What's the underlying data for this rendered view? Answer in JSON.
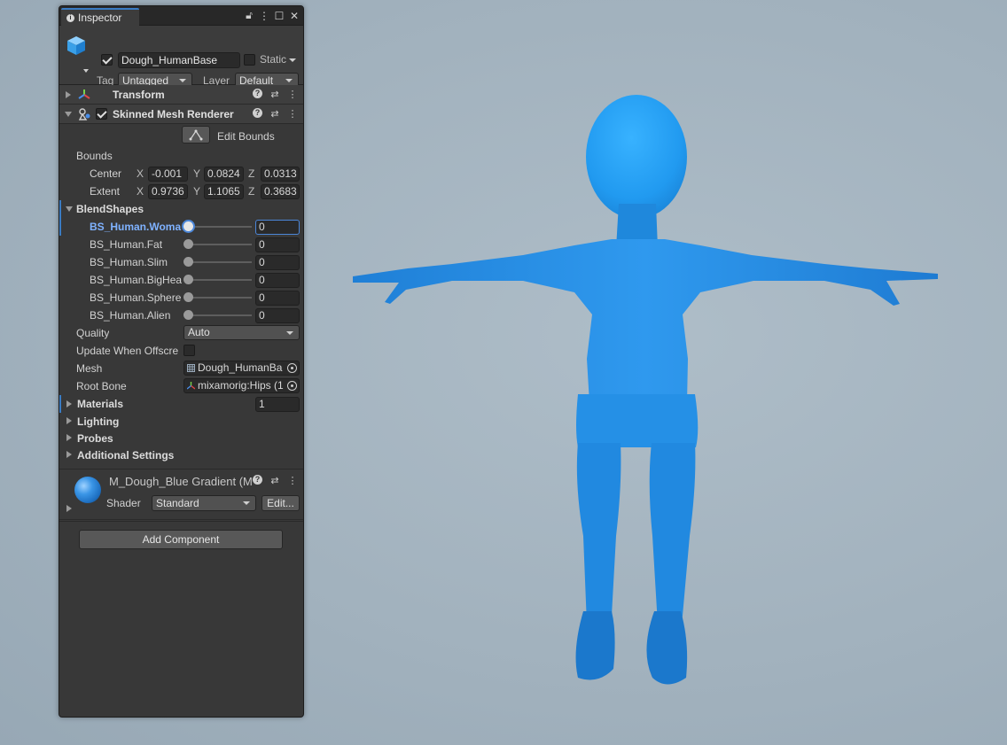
{
  "colors": {
    "character": "#2a90e8",
    "viewport": "#a3b3bf",
    "panel": "#383838",
    "accent": "#3a7cc4"
  },
  "inspector": {
    "tab_label": "Inspector",
    "window_icons": [
      "lock-icon",
      "menu-dots-icon",
      "maximize-icon",
      "close-icon"
    ],
    "object": {
      "active": true,
      "name": "Dough_HumanBase",
      "static_label": "Static",
      "tag_label": "Tag",
      "tag_value": "Untagged",
      "layer_label": "Layer",
      "layer_value": "Default"
    },
    "transform": {
      "title": "Transform"
    },
    "skinned_mesh": {
      "title": "Skinned Mesh Renderer",
      "enabled": true,
      "edit_bounds_label": "Edit Bounds",
      "bounds_label": "Bounds",
      "center_label": "Center",
      "extent_label": "Extent",
      "center": {
        "x_label": "X",
        "x": "-0.001",
        "y_label": "Y",
        "y": "0.0824",
        "z_label": "Z",
        "z": "0.0313"
      },
      "extent": {
        "x_label": "X",
        "x": "0.9736",
        "y_label": "Y",
        "y": "1.1065",
        "z_label": "Z",
        "z": "0.3683"
      },
      "blendshapes_label": "BlendShapes",
      "blendshapes": [
        {
          "name": "BS_Human.Woma",
          "value": "0"
        },
        {
          "name": "BS_Human.Fat",
          "value": "0"
        },
        {
          "name": "BS_Human.Slim",
          "value": "0"
        },
        {
          "name": "BS_Human.BigHea",
          "value": "0"
        },
        {
          "name": "BS_Human.Sphere",
          "value": "0"
        },
        {
          "name": "BS_Human.Alien",
          "value": "0"
        }
      ],
      "quality_label": "Quality",
      "quality_value": "Auto",
      "update_offscreen_label": "Update When Offscre",
      "mesh_label": "Mesh",
      "mesh_value": "Dough_HumanBa",
      "root_bone_label": "Root Bone",
      "root_bone_value": "mixamorig:Hips (1",
      "materials_label": "Materials",
      "materials_count": "1",
      "lighting_label": "Lighting",
      "probes_label": "Probes",
      "additional_label": "Additional Settings"
    },
    "material": {
      "name": "M_Dough_Blue Gradient (M",
      "shader_label": "Shader",
      "shader_value": "Standard",
      "edit_label": "Edit..."
    },
    "add_component_label": "Add Component"
  }
}
